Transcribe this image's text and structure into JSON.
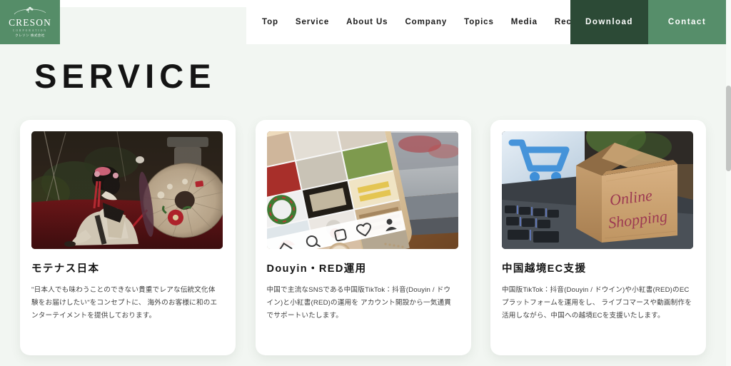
{
  "header": {
    "logo": {
      "word": "CRESON",
      "sub": "CORPORATION",
      "jp": "クレソン 株式会社"
    },
    "nav_items": [
      {
        "label": "Top"
      },
      {
        "label": "Service"
      },
      {
        "label": "About Us"
      },
      {
        "label": "Company"
      },
      {
        "label": "Topics"
      },
      {
        "label": "Media"
      },
      {
        "label": "Recruit"
      }
    ],
    "download_label": "Download",
    "contact_label": "Contact",
    "colors": {
      "logo_green": "#558d68",
      "download_green": "#2c4a36",
      "contact_green": "#568e6a",
      "page_bg": "#f2f6f2"
    }
  },
  "main": {
    "page_title": "SERVICE",
    "cards": [
      {
        "image_alt": "kimono-woman-with-wagasa-umbrella",
        "title": "モテナス日本",
        "description": "\"日本人でも味わうことのできない貴重でレアな伝統文化体験をお届けしたい\"をコンセプトに、 海外のお客様に和のエンターテイメントを提供しております。"
      },
      {
        "image_alt": "smartphone-showing-social-media-photo-grid",
        "title": "Douyin・RED運用",
        "description": "中国で主流なSNSである中国版TikTok：抖音(Douyin / ドウイン)と小紅書(RED)の運用を アカウント開設から一気通貫でサポートいたします。"
      },
      {
        "image_alt": "online-shopping-cardboard-box-on-laptop",
        "title": "中国越境EC支援",
        "description": "中国版TikTok：抖音(Douyin / ドウイン)や小紅書(RED)のECプラットフォームを運用をし、 ライブコマースや動画制作を活用しながら、中国への越境ECを支援いたします。"
      }
    ]
  },
  "scrollbar": {
    "position_label": "near-top"
  }
}
